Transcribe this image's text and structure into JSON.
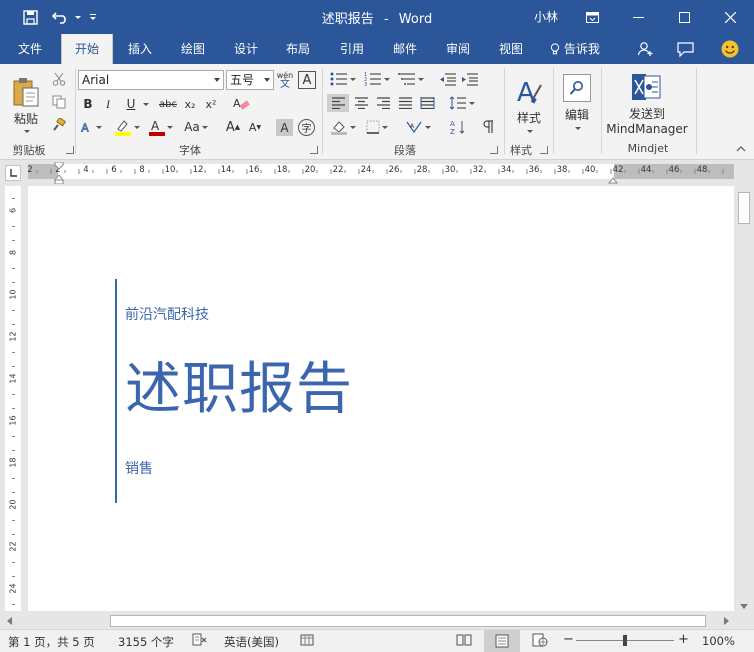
{
  "titlebar": {
    "document_title": "述职报告",
    "separator": "-",
    "app_name": "Word",
    "user_name": "小林",
    "quick_access": [
      "save-icon",
      "undo-icon",
      "customize-qat-icon"
    ],
    "window_buttons": [
      "ribbon-display-icon",
      "minimize-icon",
      "maximize-icon",
      "close-icon"
    ]
  },
  "tabs": {
    "items": [
      "文件",
      "开始",
      "插入",
      "绘图",
      "设计",
      "布局",
      "引用",
      "邮件",
      "审阅",
      "视图"
    ],
    "active": "开始",
    "tell_me": "告诉我",
    "right_icons": [
      "share-icon",
      "comments-icon",
      "smiley-feedback-icon"
    ]
  },
  "ribbon": {
    "clipboard": {
      "label": "剪贴板",
      "paste": "粘贴"
    },
    "font": {
      "label": "字体",
      "font_name": "Arial",
      "font_size": "五号",
      "phonetic_top": "wén",
      "phonetic_bottom": "文",
      "border_char": "A",
      "bold": "B",
      "italic": "I",
      "underline": "U",
      "strike": "abc",
      "subscript": "x₂",
      "superscript": "x²",
      "grow": "A",
      "shrink": "A",
      "case": "Aa",
      "shade_char": "A",
      "enclose_char": "字",
      "accent_color": "#2b579a",
      "highlight_color": "#ffff00",
      "font_color": "#c00000"
    },
    "paragraph": {
      "label": "段落"
    },
    "styles": {
      "label": "样式",
      "button": "样式"
    },
    "editing": {
      "button": "编辑"
    },
    "mindjet": {
      "label": "Mindjet",
      "send_line1": "发送到",
      "send_line2": "MindManager"
    }
  },
  "ruler": {
    "labels": [
      "2",
      "2",
      "4",
      "6",
      "8",
      "10",
      "12",
      "14",
      "16",
      "18",
      "20",
      "22",
      "24",
      "26",
      "28",
      "30",
      "32",
      "34",
      "36",
      "38",
      "40",
      "42",
      "44",
      "46",
      "48"
    ],
    "vertical_labels": [
      "6",
      "8",
      "10",
      "12",
      "14",
      "16",
      "18",
      "20",
      "22",
      "24"
    ]
  },
  "document": {
    "company": "前沿汽配科技",
    "title": "述职报告",
    "department": "销售",
    "accent_color": "#3b66ad"
  },
  "status": {
    "page": "第 1 页，共 5 页",
    "words": "3155 个字",
    "language": "英语(美国)",
    "zoom": "100%",
    "zoom_minus": "−",
    "zoom_plus": "+",
    "zoom_level": 1.0
  }
}
